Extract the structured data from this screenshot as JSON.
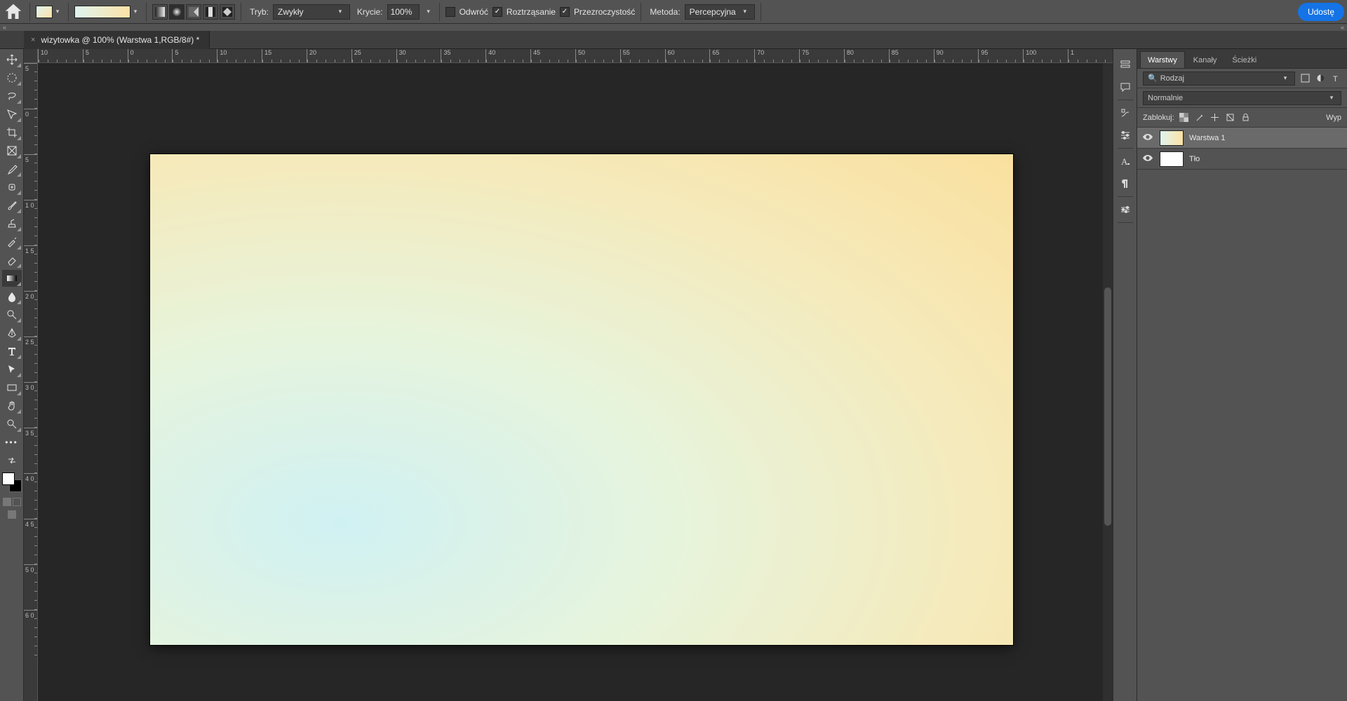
{
  "optionsBar": {
    "mode_label": "Tryb:",
    "mode_value": "Zwykły",
    "opacity_label": "Krycie:",
    "opacity_value": "100%",
    "reverse_label": "Odwróć",
    "dither_label": "Roztrząsanie",
    "transparency_label": "Przezroczystość",
    "method_label": "Metoda:",
    "method_value": "Percepcyjna",
    "share_label": "Udostę"
  },
  "document": {
    "tab_title": "wizytowka @ 100% (Warstwa 1,RGB/8#) *"
  },
  "rulerH": [
    "10",
    "5",
    "0",
    "5",
    "10",
    "15",
    "20",
    "25",
    "30",
    "35",
    "40",
    "45",
    "50",
    "55",
    "60",
    "65",
    "70",
    "75",
    "80",
    "85",
    "90",
    "95",
    "100",
    "1"
  ],
  "rulerV": [
    "5",
    "0",
    "5",
    "1 0",
    "1 5",
    "2 0",
    "2 5",
    "3 0",
    "3 5",
    "4 0",
    "4 5",
    "5 0",
    "6 0"
  ],
  "panels": {
    "tabs": {
      "layers": "Warstwy",
      "channels": "Kanały",
      "paths": "Ścieżki"
    },
    "filter_label": "Rodzaj",
    "blend_label": "Normalnie",
    "lock_label": "Zablokuj:",
    "fill_label": "Wyp",
    "layers": [
      {
        "name": "Warstwa 1",
        "selected": true,
        "grad": true
      },
      {
        "name": "Tło",
        "selected": false,
        "grad": false
      }
    ]
  }
}
